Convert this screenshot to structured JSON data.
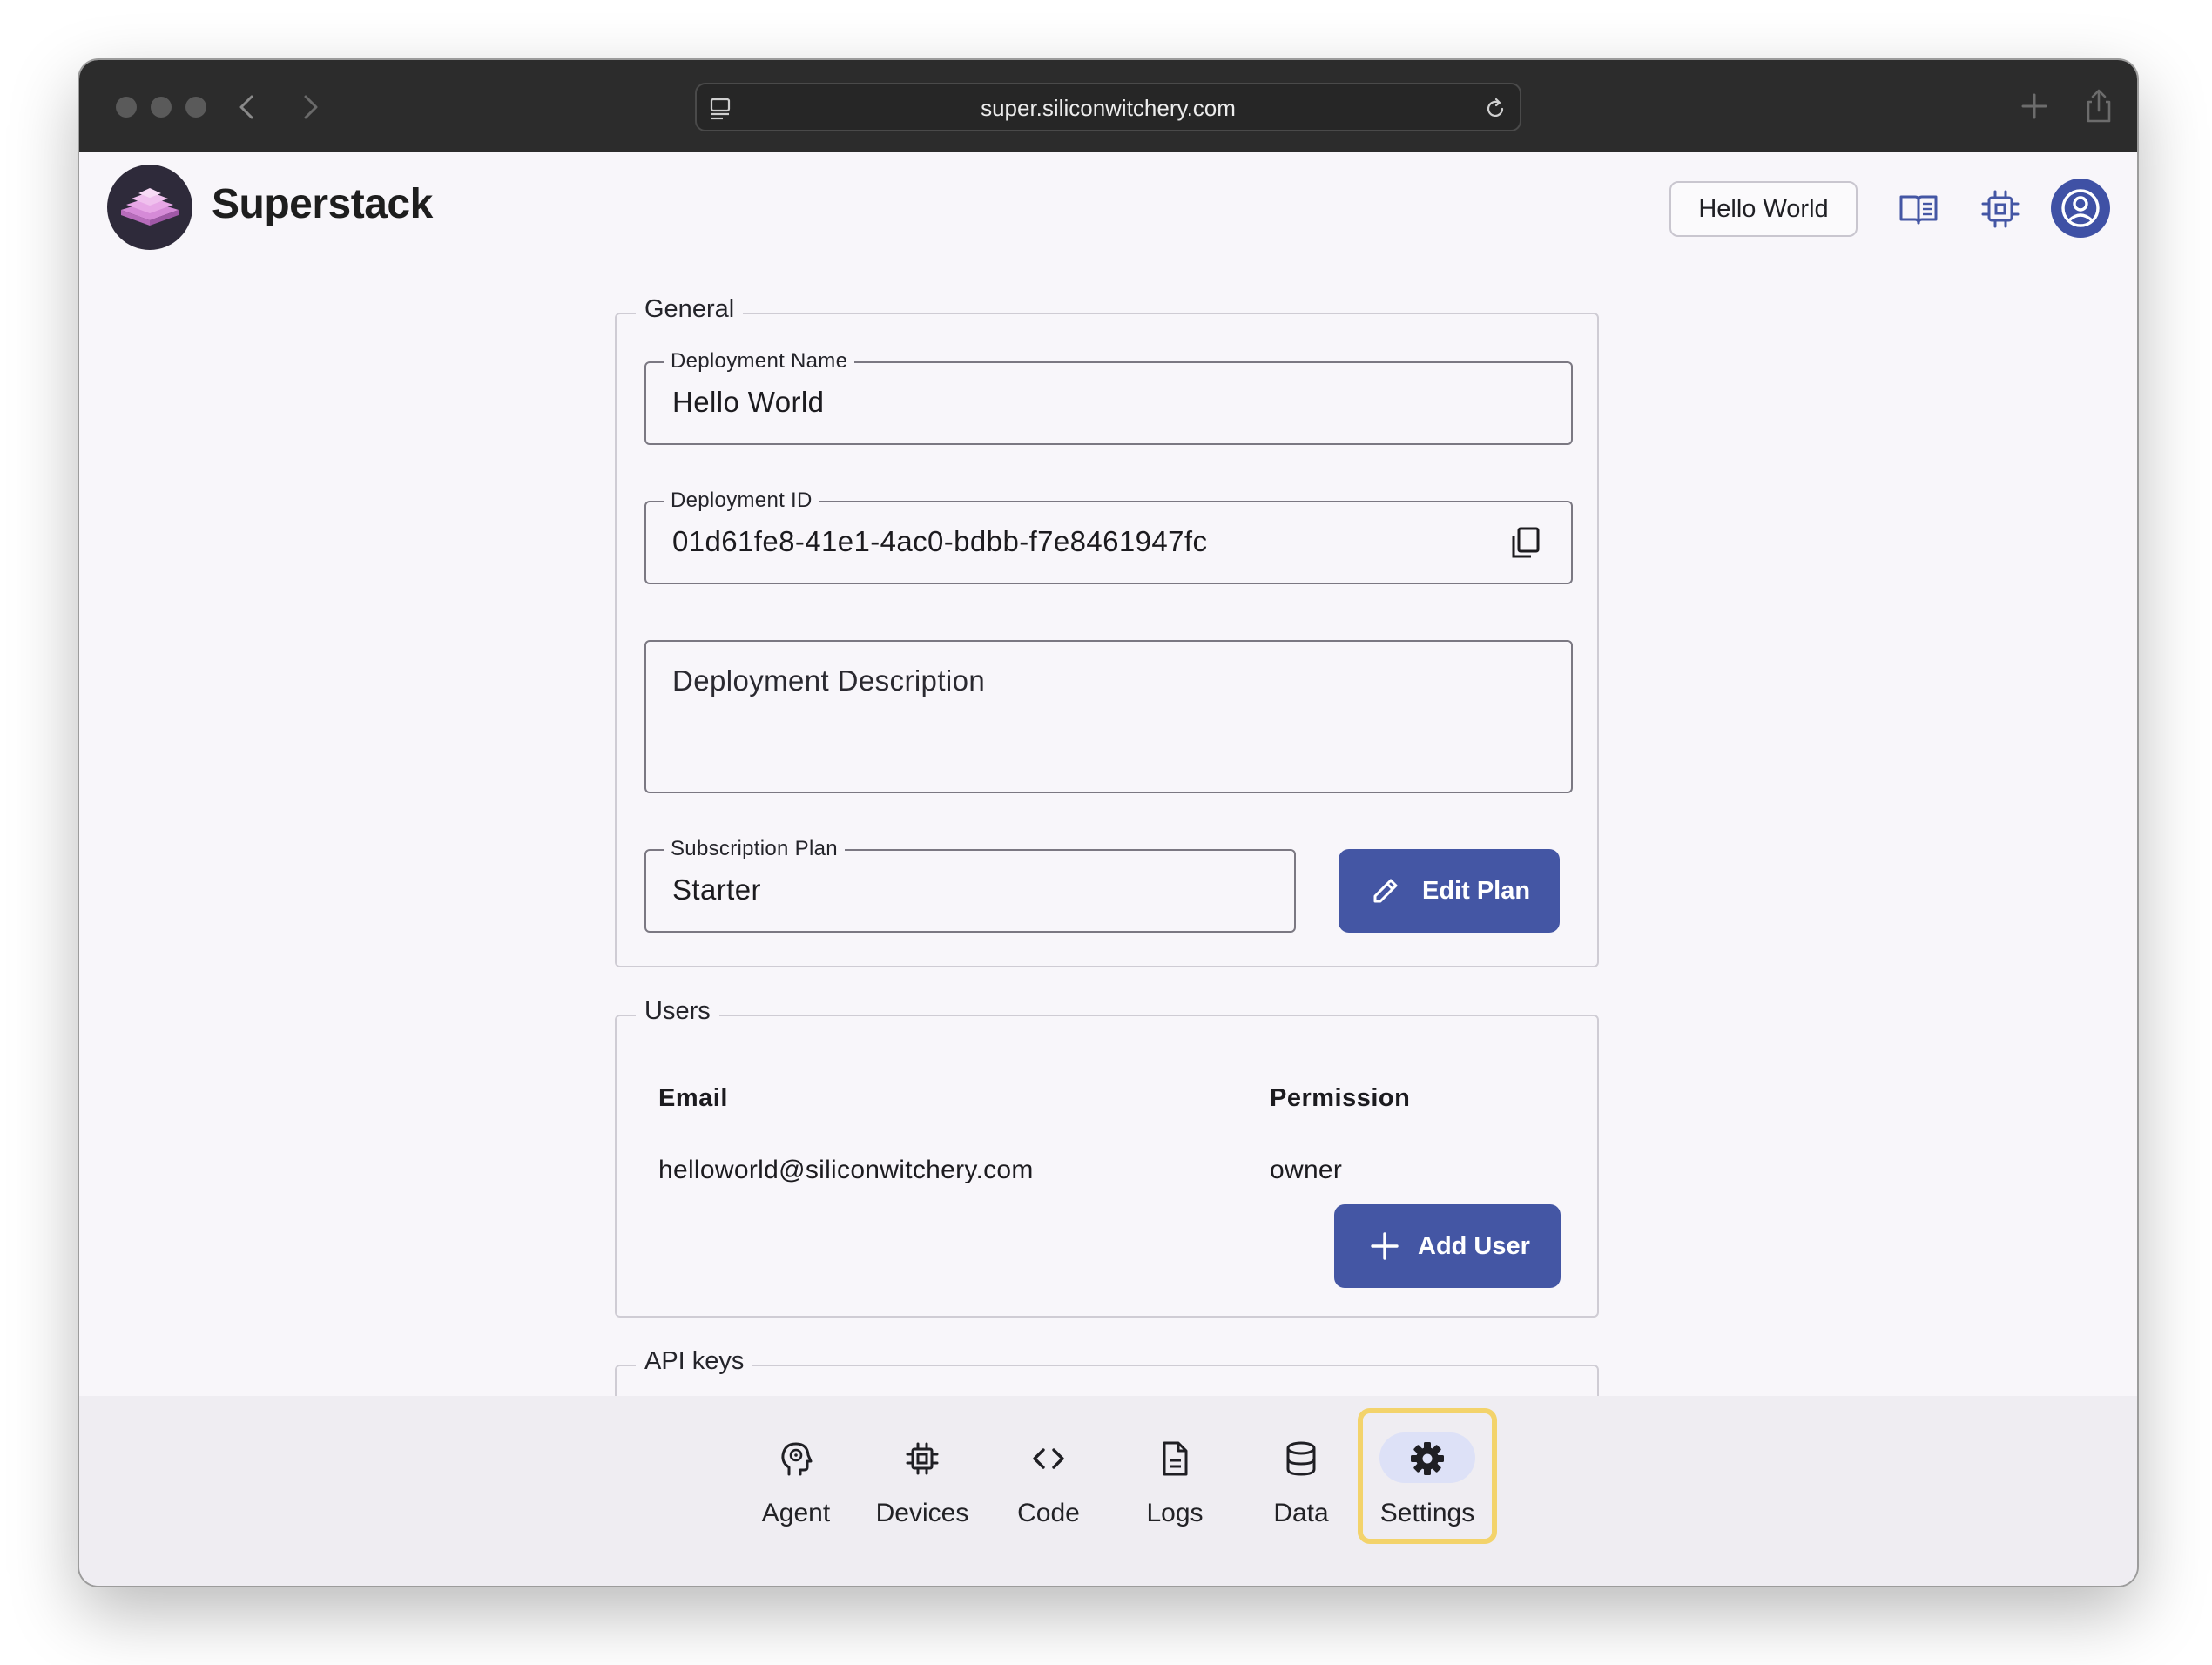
{
  "browser": {
    "url": "super.siliconwitchery.com"
  },
  "header": {
    "brand": "Superstack",
    "deployment_chip": "Hello World",
    "icons": [
      "docs-book-icon",
      "device-chip-icon",
      "account-icon"
    ]
  },
  "general": {
    "legend": "General",
    "deployment_name": {
      "label": "Deployment Name",
      "value": "Hello World"
    },
    "deployment_id": {
      "label": "Deployment ID",
      "value": "01d61fe8-41e1-4ac0-bdbb-f7e8461947fc"
    },
    "deployment_description": {
      "placeholder": "Deployment Description"
    },
    "subscription_plan": {
      "label": "Subscription Plan",
      "value": "Starter"
    },
    "edit_plan_label": "Edit Plan"
  },
  "users": {
    "legend": "Users",
    "columns": [
      "Email",
      "Permission"
    ],
    "rows": [
      {
        "email": "helloworld@siliconwitchery.com",
        "permission": "owner"
      }
    ],
    "add_user_label": "Add User"
  },
  "api_keys": {
    "legend": "API keys"
  },
  "bottom_nav": {
    "items": [
      {
        "label": "Agent",
        "icon": "agent-head-icon"
      },
      {
        "label": "Devices",
        "icon": "chip-icon"
      },
      {
        "label": "Code",
        "icon": "code-icon"
      },
      {
        "label": "Logs",
        "icon": "document-icon"
      },
      {
        "label": "Data",
        "icon": "database-icon"
      },
      {
        "label": "Settings",
        "icon": "gear-icon"
      }
    ],
    "active": "Settings"
  },
  "colors": {
    "primary": "#4456a4",
    "highlight": "#f3d36b",
    "background": "#f8f6fa"
  }
}
